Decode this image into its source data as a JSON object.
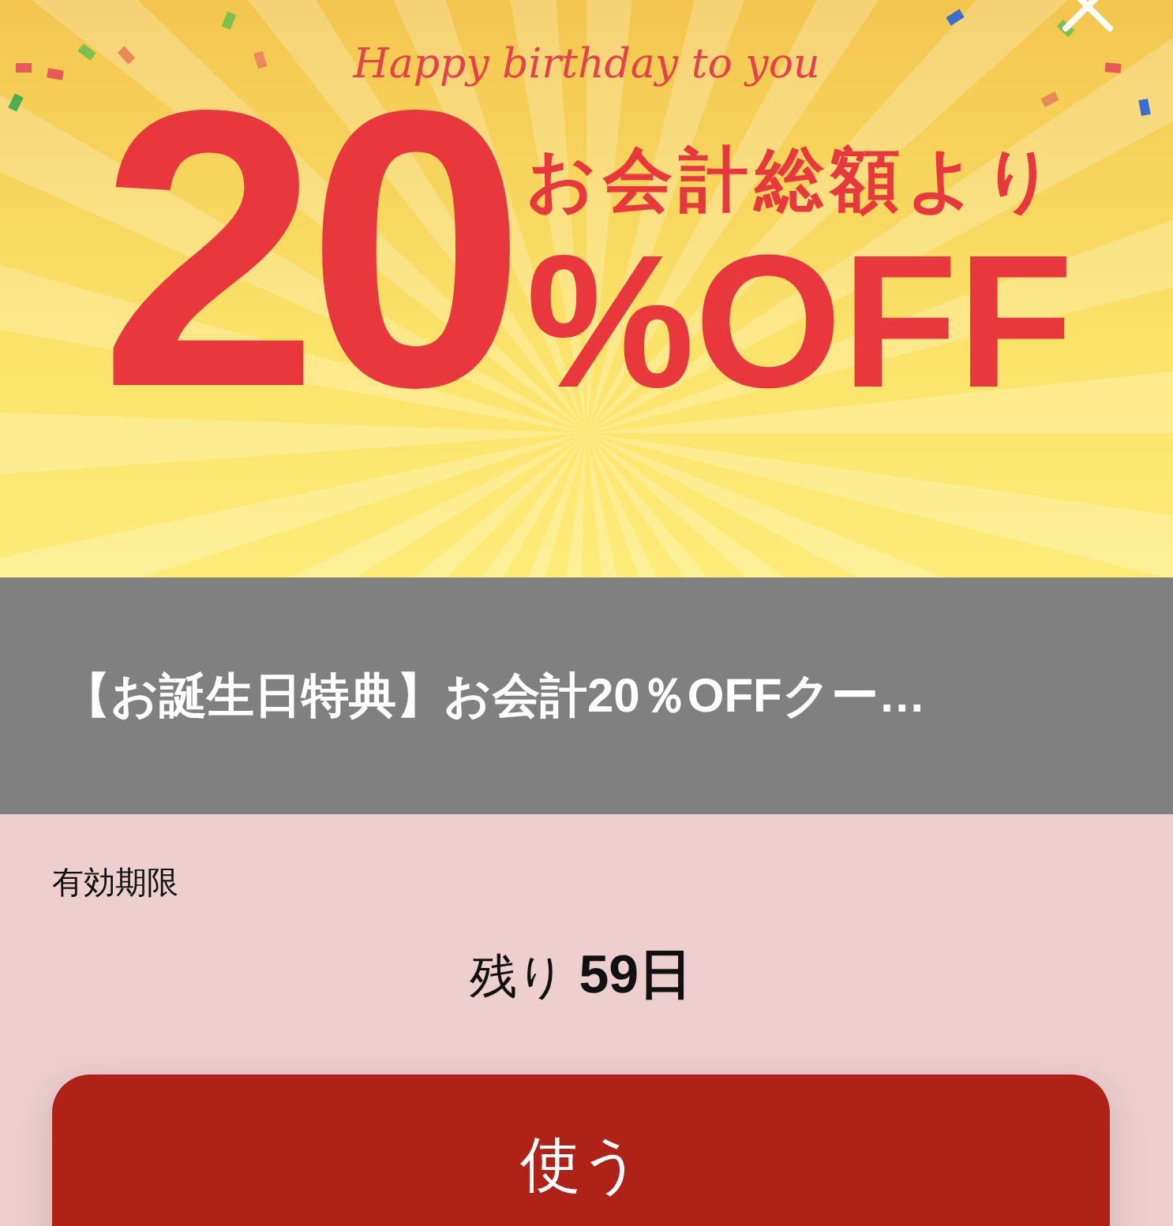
{
  "banner": {
    "tagline": "Happy birthday to you",
    "big_number": "20",
    "subtitle": "お会計総額より",
    "discount": "%OFF"
  },
  "coupon": {
    "title": "【お誕生日特典】お会計20％OFFクー…"
  },
  "expiry": {
    "label": "有効期限",
    "remaining": "残り **59日**"
  },
  "button": {
    "label": "使う"
  }
}
